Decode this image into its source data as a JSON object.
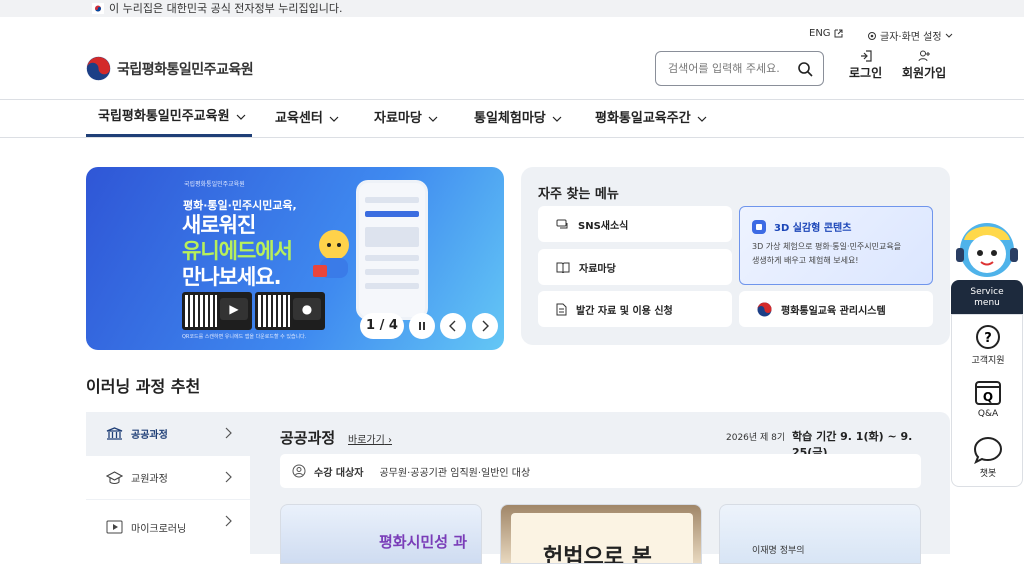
{
  "gov_bar": {
    "text": "이 누리집은 대한민국 공식 전자정부 누리집입니다."
  },
  "header": {
    "site_name": "국립평화통일민주교육원",
    "lang_link": "ENG",
    "display_settings": "글자·화면 설정",
    "search_placeholder": "검색어를 입력해 주세요.",
    "login": "로그인",
    "signup": "회원가입"
  },
  "gnb": {
    "items": [
      "국립평화통일민주교육원",
      "교육센터",
      "자료마당",
      "통일체험마당",
      "평화통일교육주간"
    ]
  },
  "banner": {
    "org": "국립평화통일민주교육원",
    "headline_small": "평화·통일·민주시민교육,",
    "line1": "새로워진",
    "line2": "유니에드에서",
    "line3": "만나보세요.",
    "note": "QR코드를 스캔하면 유니에드 앱을 다운로드할 수 있습니다.",
    "counter": "1 / 4"
  },
  "faq": {
    "title": "자주 찾는 메뉴",
    "items": [
      {
        "label": "SNS새소식",
        "icon": "chat-icon"
      },
      {
        "label": "자료마당",
        "icon": "book-icon"
      },
      {
        "label": "발간 자료 및 이용 신청",
        "icon": "document-icon"
      },
      {
        "label": "평화통일교육 관리시스템",
        "icon": "taegeuk-icon"
      }
    ],
    "feature": {
      "label": "3D 실감형 콘텐츠",
      "desc_line1": "3D 가상 체험으로 평화·통일·민주시민교육을",
      "desc_line2": "생생하게 배우고 체험해 보세요!"
    }
  },
  "elearning": {
    "title": "이러닝 과정 추천",
    "tabs": [
      "공공과정",
      "교원과정",
      "마이크로러닝"
    ],
    "course_title": "공공과정",
    "more_link": "바로가기",
    "term": "2026년 제 8기",
    "period": "학습 기간 9. 1(화) ~ 9. 25(금)",
    "target_label": "수강 대상자",
    "target_value": "공무원·공공기관 임직원·일반인 대상",
    "card1_text": "평화시민성 과",
    "card2_text": "헌법으로 본",
    "card3_text": "이재명 정부의"
  },
  "side_menu": {
    "tag_line1": "Service",
    "tag_line2": "menu",
    "items": [
      "고객지원",
      "Q&A",
      "챗봇"
    ]
  },
  "colors": {
    "navy": "#1f3f77",
    "accent_blue": "#1c46b8",
    "banner_green": "#b8f05a"
  }
}
